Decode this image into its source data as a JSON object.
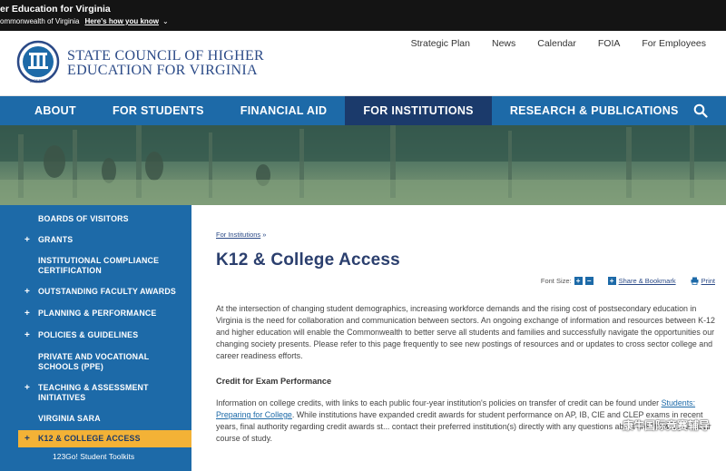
{
  "gov_banner": {
    "title": "er Education for Virginia",
    "official": "ommonwealth of Virginia",
    "how_link": "Here's how you know"
  },
  "header": {
    "org_line1": "STATE COUNCIL OF HIGHER",
    "org_line2": "EDUCATION FOR VIRGINIA",
    "seal_text": "SCHEV",
    "util_nav": [
      "Strategic Plan",
      "News",
      "Calendar",
      "FOIA",
      "For Employees"
    ]
  },
  "main_nav": {
    "items": [
      "ABOUT",
      "FOR STUDENTS",
      "FINANCIAL AID",
      "FOR INSTITUTIONS",
      "RESEARCH & PUBLICATIONS"
    ],
    "active": "FOR INSTITUTIONS"
  },
  "sidebar": {
    "items": [
      {
        "label": "BOARDS OF VISITORS",
        "plus": ""
      },
      {
        "label": "GRANTS",
        "plus": "+"
      },
      {
        "label": "INSTITUTIONAL COMPLIANCE CERTIFICATION",
        "plus": ""
      },
      {
        "label": "OUTSTANDING FACULTY AWARDS",
        "plus": "+"
      },
      {
        "label": "PLANNING & PERFORMANCE",
        "plus": "+"
      },
      {
        "label": "POLICIES & GUIDELINES",
        "plus": "+"
      },
      {
        "label": "PRIVATE AND VOCATIONAL SCHOOLS (PPE)",
        "plus": ""
      },
      {
        "label": "TEACHING & ASSESSMENT INITIATIVES",
        "plus": "+"
      },
      {
        "label": "VIRGINIA SARA",
        "plus": ""
      },
      {
        "label": "K12 & COLLEGE ACCESS",
        "plus": "+"
      }
    ],
    "sub_item": "123Go! Student Toolkits"
  },
  "content": {
    "breadcrumb": "For Institutions",
    "breadcrumb_sep": "»",
    "title": "K12 & College Access",
    "font_size_label": "Font Size:",
    "share_label": "Share & Bookmark",
    "print_label": "Print",
    "intro": "At the intersection of changing student demographics, increasing workforce demands and the rising cost of postsecondary education in Virginia is the need for collaboration and communication between sectors. An ongoing exchange of information and resources between K-12 and higher education will enable the Commonwealth to better serve all students and families and successfully navigate the opportunities our changing society presents. Please refer to this page frequently to see new postings of resources and or updates to cross sector college and career readiness efforts.",
    "subhead": "Credit for Exam Performance",
    "p2_before": "Information on college credits, with links to each public four-year institution's policies on transfer of credit can be found under ",
    "p2_link": "Students: Preparing for College",
    "p2_after": ". While institutions have expanded credit awards for student performance on AP, IB, CIE and CLEP exams in recent years, final authority regarding credit awards st... contact their preferred institution(s) directly with any questions about credit aw... particular course of study.",
    "watermark": "康牛国际竞赛辅导"
  },
  "colors": {
    "nav_blue": "#1d6aa8",
    "nav_active": "#1b3a6b",
    "sidebar_active": "#f3b236",
    "title_navy": "#2b3f6e"
  }
}
